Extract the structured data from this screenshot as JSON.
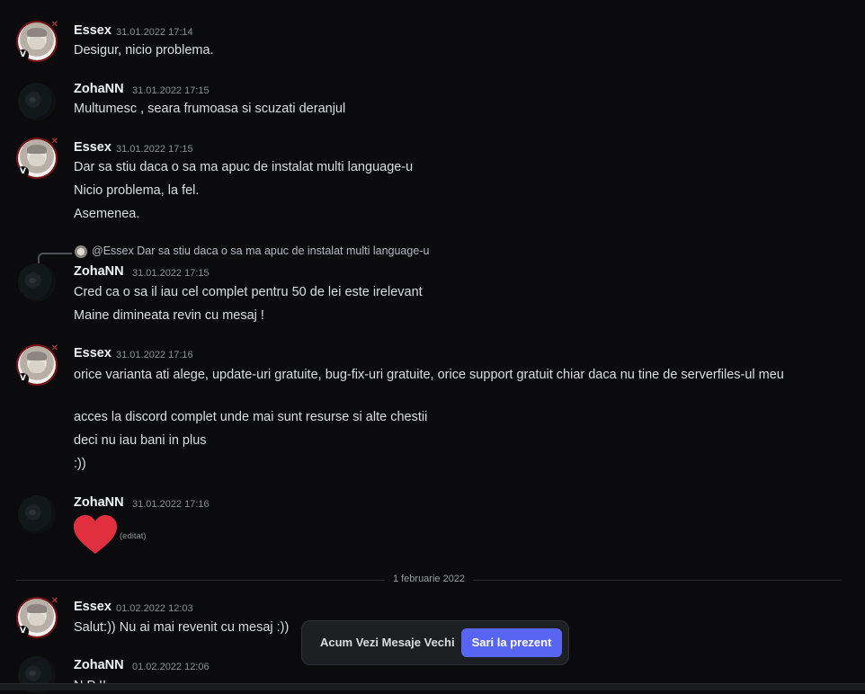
{
  "messages": [
    {
      "author": "Essex",
      "time": "31.01.2022 17:14",
      "avatar": "essex",
      "lines": [
        "Desigur, nicio problema."
      ]
    },
    {
      "author": "ZohaNN",
      "time": "31.01.2022 17:15",
      "avatar": "zoha",
      "lines": [
        "Multumesc , seara frumoasa si scuzati deranjul"
      ]
    },
    {
      "author": "Essex",
      "time": "31.01.2022 17:15",
      "avatar": "essex",
      "lines": [
        "Dar sa stiu daca o sa ma apuc de instalat multi language-u",
        "Nicio problema, la fel.",
        "Asemenea."
      ]
    },
    {
      "author": "ZohaNN",
      "time": "31.01.2022 17:15",
      "avatar": "zoha",
      "reply": {
        "mention": "@Essex",
        "text": "Dar sa stiu daca o sa ma apuc de instalat multi language-u"
      },
      "lines": [
        "Cred ca o sa il iau cel complet pentru 50 de lei este irelevant",
        "Maine dimineata revin cu mesaj !"
      ]
    },
    {
      "author": "Essex",
      "time": "31.01.2022 17:16",
      "avatar": "essex",
      "lines": [
        "orice varianta ati alege, update-uri gratuite, bug-fix-uri gratuite, orice support gratuit chiar daca nu tine de serverfiles-ul meu",
        "acces la discord complet unde mai sunt resurse si alte chestii",
        "deci nu iau bani in plus",
        ":))"
      ]
    },
    {
      "author": "ZohaNN",
      "time": "31.01.2022 17:16",
      "avatar": "zoha",
      "emoji": "heart-emoji",
      "edited": "(editat)"
    },
    {
      "author": "Essex",
      "time": "01.02.2022 12:03",
      "avatar": "essex",
      "lines": [
        "Salut:)) Nu ai mai revenit cu mesaj :))"
      ]
    },
    {
      "author": "ZohaNN",
      "time": "01.02.2022 12:06",
      "avatar": "zoha",
      "lines": [
        "N                                               P       !!"
      ]
    }
  ],
  "date_divider": "1 februarie 2022",
  "toast": {
    "label": "Acum Vezi Mesaje Vechi",
    "button": "Sari la prezent"
  },
  "colors": {
    "background": "#0b0b0d",
    "accent": "#5865f2",
    "heart": "#e0303f"
  }
}
